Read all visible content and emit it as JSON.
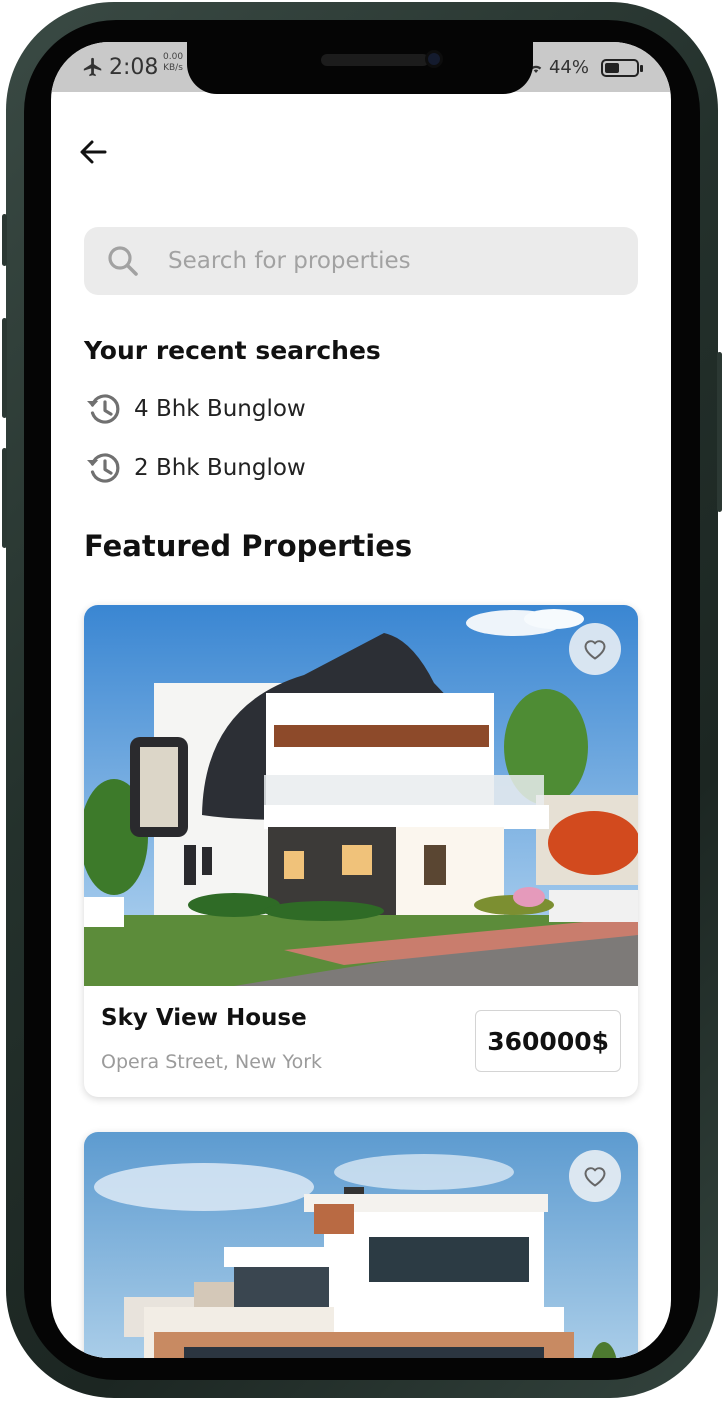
{
  "status_bar": {
    "time": "2:08",
    "net_speed_value": "0.00",
    "net_speed_unit": "KB/s",
    "battery": "44%"
  },
  "icons": {
    "back": "arrow-left-icon",
    "search": "search-icon",
    "history": "history-icon",
    "favorite": "heart-icon",
    "airplane": "airplane-icon",
    "wifi": "wifi-icon",
    "battery": "battery-icon"
  },
  "search": {
    "placeholder": "Search for properties",
    "value": ""
  },
  "recent": {
    "title": "Your recent searches",
    "items": [
      {
        "label": "4 Bhk Bunglow"
      },
      {
        "label": "2 Bhk Bunglow"
      }
    ]
  },
  "featured": {
    "title": "Featured Properties",
    "properties": [
      {
        "name": "Sky View House",
        "address": "Opera Street, New York",
        "price": "360000$"
      }
    ]
  },
  "colors": {
    "background": "#ffffff",
    "search_bg": "#ebebeb",
    "placeholder": "#a2a2a2",
    "subtext": "#9b9b9b",
    "frame": "#2b3833"
  }
}
